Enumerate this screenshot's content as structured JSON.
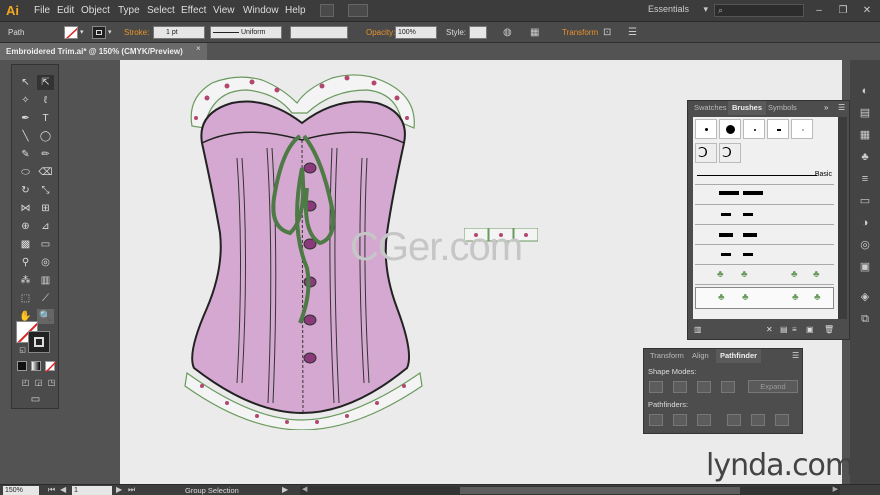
{
  "app": {
    "logo": "Ai"
  },
  "menubar": {
    "items": [
      "File",
      "Edit",
      "Object",
      "Type",
      "Select",
      "Effect",
      "View",
      "Window",
      "Help"
    ],
    "workspace": "Essentials"
  },
  "control_bar": {
    "selection_type": "Path",
    "stroke_label": "Stroke:",
    "stroke_value": "1 pt",
    "stroke_profile": "Uniform",
    "opacity_label": "Opacity:",
    "opacity_value": "100%",
    "style_label": "Style:",
    "transform_label": "Transform"
  },
  "document": {
    "tab_title": "Embroidered Trim.ai* @ 150% (CMYK/Preview)",
    "close_glyph": "×"
  },
  "brushes_panel": {
    "tabs": [
      "Swatches",
      "Brushes",
      "Symbols"
    ],
    "active_tab": "Brushes",
    "basic_label": "Basic"
  },
  "pathfinder_panel": {
    "tabs": [
      "Transform",
      "Align",
      "Pathfinder"
    ],
    "active_tab": "Pathfinder",
    "shape_modes_label": "Shape Modes:",
    "expand_label": "Expand",
    "pathfinders_label": "Pathfinders:"
  },
  "status_bar": {
    "zoom": "150%",
    "page": "1",
    "tool_name": "Group Selection"
  },
  "watermarks": {
    "center": "CGer.com",
    "corner": "lynda.com"
  },
  "colors": {
    "corset_fill": "#d4a8d0",
    "lace_ribbon": "#4e7a45",
    "ui_accent": "#e8922b"
  }
}
